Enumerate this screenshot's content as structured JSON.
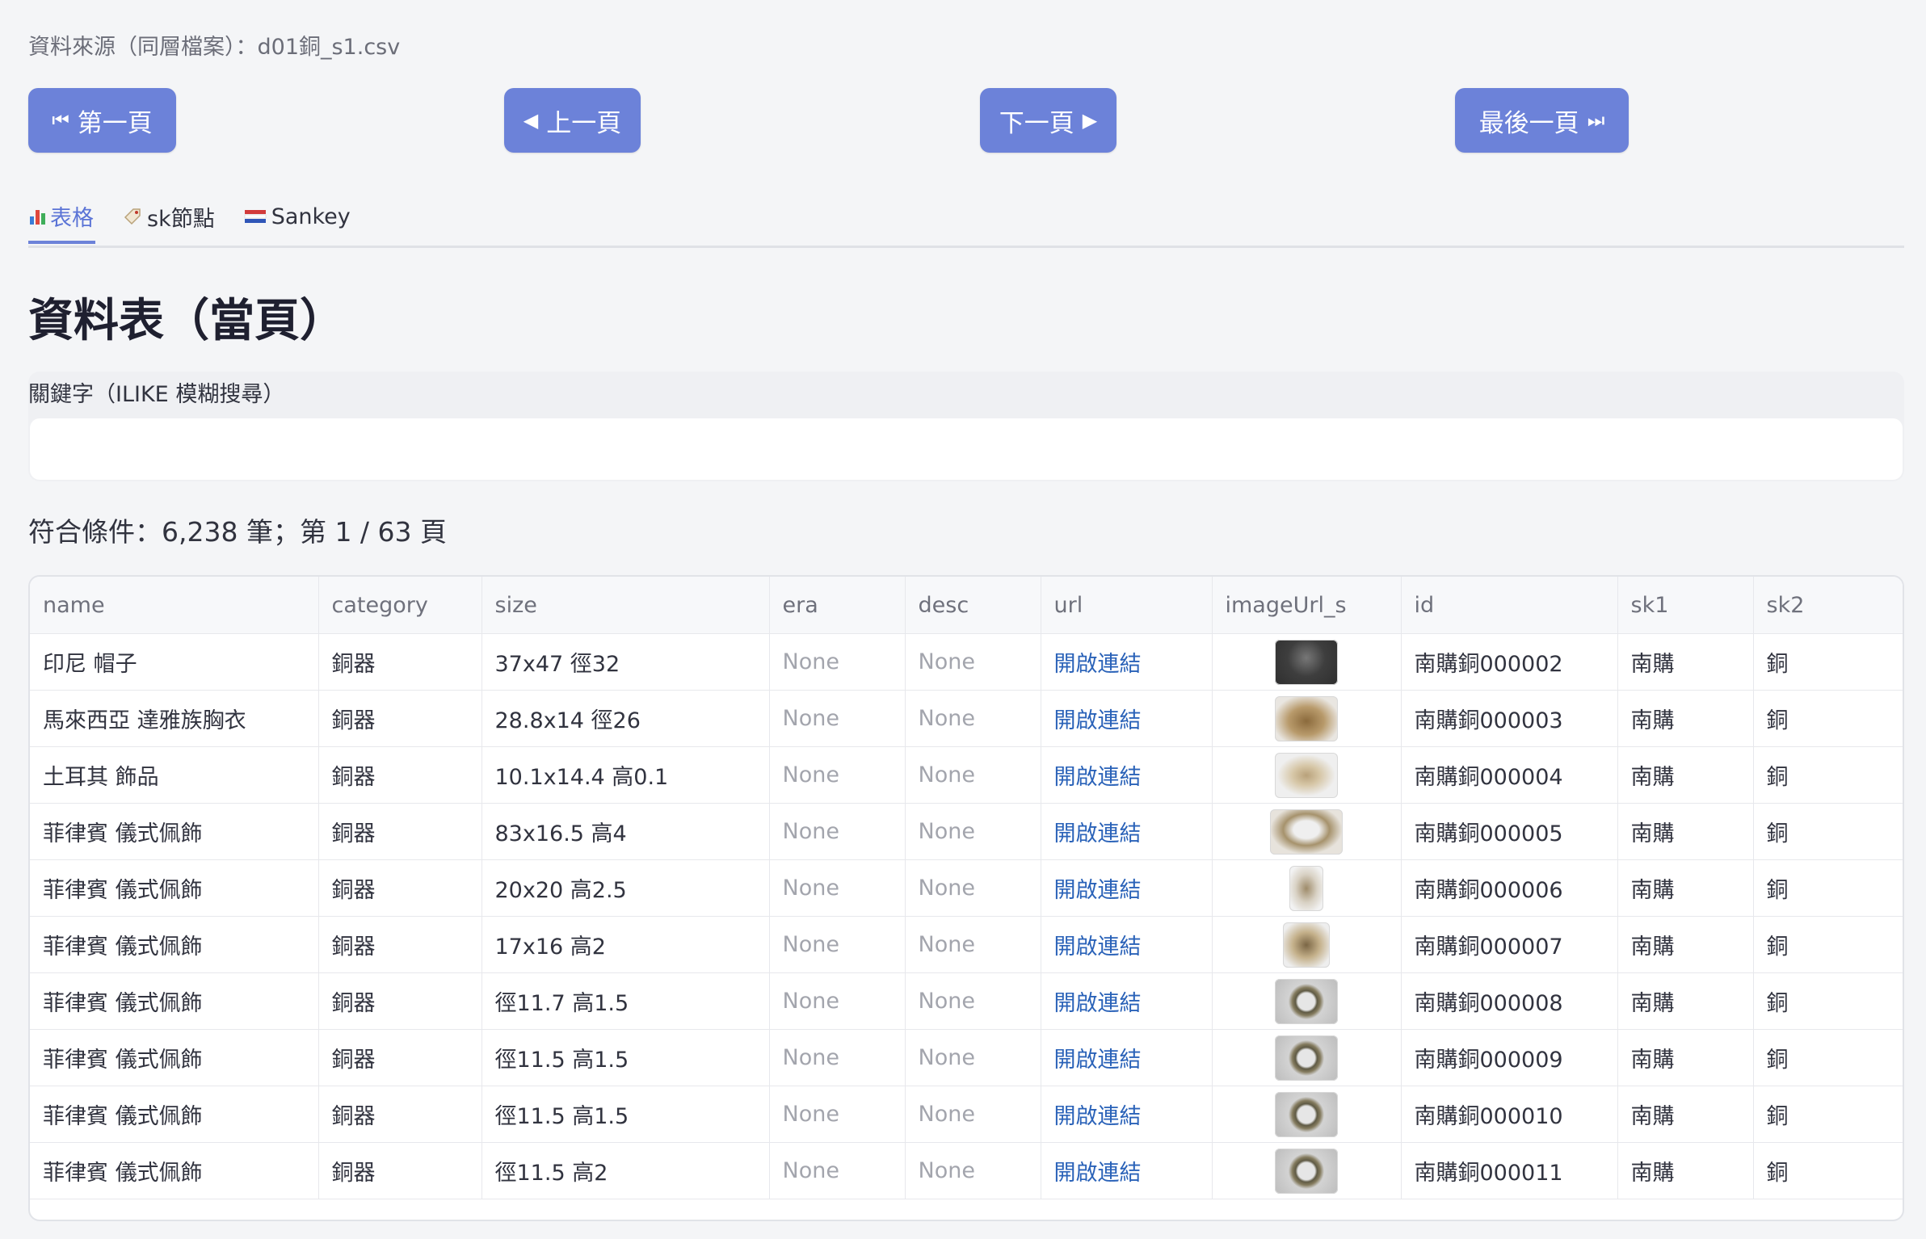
{
  "header": {
    "source_caption": "資料來源（同層檔案）：d01銅_s1.csv"
  },
  "nav_buttons": {
    "first": {
      "glyph": "⏮",
      "label": "第一頁"
    },
    "prev": {
      "glyph": "◀",
      "label": "上一頁"
    },
    "next": {
      "glyph": "▶",
      "label": "下一頁"
    },
    "last": {
      "glyph": "⏭",
      "label": "最後一頁"
    }
  },
  "tabs": [
    {
      "label": "表格",
      "icon": "bar-chart-icon",
      "active": true
    },
    {
      "label": "sk節點",
      "icon": "label-tag-icon",
      "active": false
    },
    {
      "label": "Sankey",
      "icon": "sankey-flow-icon",
      "active": false
    }
  ],
  "main": {
    "title": "資料表（當頁）",
    "search": {
      "label": "關鍵字（ILIKE 模糊搜尋）",
      "value": "",
      "placeholder": ""
    },
    "result_count": "符合條件：6,238 筆；第 1 / 63 頁"
  },
  "table": {
    "columns": [
      "name",
      "category",
      "size",
      "era",
      "desc",
      "url",
      "imageUrl_s",
      "id",
      "sk1",
      "sk2"
    ],
    "rows": [
      {
        "name": "印尼 帽子",
        "category": "銅器",
        "size": "37x47 徑32",
        "era": "None",
        "desc": "None",
        "url": "開啟連結",
        "image": "th-dark",
        "id": "南購銅000002",
        "sk1": "南購",
        "sk2": "銅"
      },
      {
        "name": "馬來西亞 達雅族胸衣",
        "category": "銅器",
        "size": "28.8x14 徑26",
        "era": "None",
        "desc": "None",
        "url": "開啟連結",
        "image": "th-basket",
        "id": "南購銅000003",
        "sk1": "南購",
        "sk2": "銅"
      },
      {
        "name": "土耳其 飾品",
        "category": "銅器",
        "size": "10.1x14.4 高0.1",
        "era": "None",
        "desc": "None",
        "url": "開啟連結",
        "image": "th-tree",
        "id": "南購銅000004",
        "sk1": "南購",
        "sk2": "銅"
      },
      {
        "name": "菲律賓 儀式佩飾",
        "category": "銅器",
        "size": "83x16.5 高4",
        "era": "None",
        "desc": "None",
        "url": "開啟連結",
        "image": "th-necklace",
        "id": "南購銅000005",
        "sk1": "南購",
        "sk2": "銅"
      },
      {
        "name": "菲律賓 儀式佩飾",
        "category": "銅器",
        "size": "20x20 高2.5",
        "era": "None",
        "desc": "None",
        "url": "開啟連結",
        "image": "th-small",
        "id": "南購銅000006",
        "sk1": "南購",
        "sk2": "銅"
      },
      {
        "name": "菲律賓 儀式佩飾",
        "category": "銅器",
        "size": "17x16 高2",
        "era": "None",
        "desc": "None",
        "url": "開啟連結",
        "image": "th-medium",
        "id": "南購銅000007",
        "sk1": "南購",
        "sk2": "銅"
      },
      {
        "name": "菲律賓 儀式佩飾",
        "category": "銅器",
        "size": "徑11.7 高1.5",
        "era": "None",
        "desc": "None",
        "url": "開啟連結",
        "image": "th-ring",
        "id": "南購銅000008",
        "sk1": "南購",
        "sk2": "銅"
      },
      {
        "name": "菲律賓 儀式佩飾",
        "category": "銅器",
        "size": "徑11.5 高1.5",
        "era": "None",
        "desc": "None",
        "url": "開啟連結",
        "image": "th-ring",
        "id": "南購銅000009",
        "sk1": "南購",
        "sk2": "銅"
      },
      {
        "name": "菲律賓 儀式佩飾",
        "category": "銅器",
        "size": "徑11.5 高1.5",
        "era": "None",
        "desc": "None",
        "url": "開啟連結",
        "image": "th-ring",
        "id": "南購銅000010",
        "sk1": "南購",
        "sk2": "銅"
      },
      {
        "name": "菲律賓 儀式佩飾",
        "category": "銅器",
        "size": "徑11.5 高2",
        "era": "None",
        "desc": "None",
        "url": "開啟連結",
        "image": "th-ring",
        "id": "南購銅000011",
        "sk1": "南購",
        "sk2": "銅"
      }
    ]
  },
  "colors": {
    "accent": "#6c82d9",
    "link": "#2a62b8",
    "background": "#f4f5f7"
  }
}
